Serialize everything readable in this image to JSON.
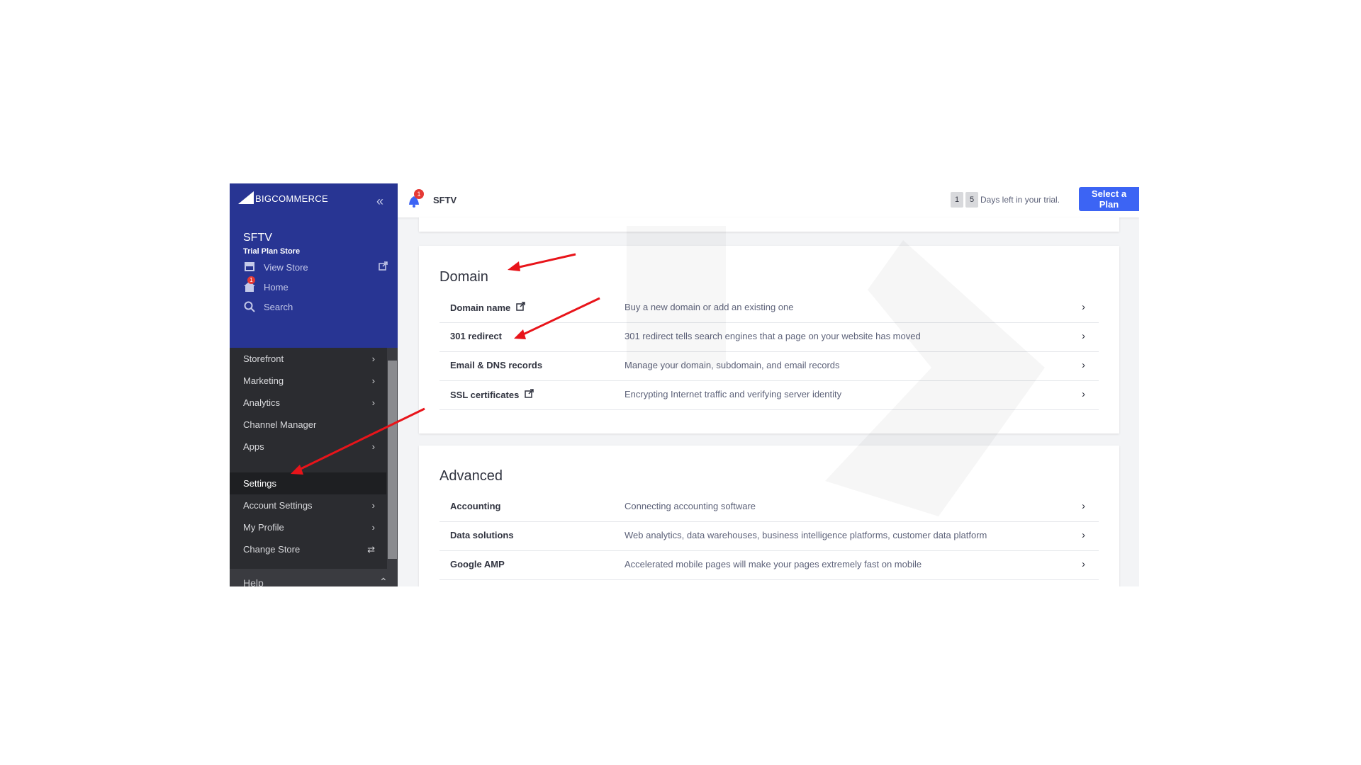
{
  "logo": {
    "text": "BIGCOMMERCE"
  },
  "store": {
    "name": "SFTV",
    "plan": "Trial Plan Store"
  },
  "sidebar_top": {
    "view_store": "View Store",
    "home": "Home",
    "home_badge": "1",
    "search": "Search"
  },
  "menu": [
    {
      "label": "Storefront",
      "chevron": "›"
    },
    {
      "label": "Marketing",
      "chevron": "›"
    },
    {
      "label": "Analytics",
      "chevron": "›"
    },
    {
      "label": "Channel Manager",
      "chevron": ""
    },
    {
      "label": "Apps",
      "chevron": "›"
    },
    {
      "label": "Settings",
      "chevron": ""
    },
    {
      "label": "Account Settings",
      "chevron": "›"
    },
    {
      "label": "My Profile",
      "chevron": "›"
    },
    {
      "label": "Change Store",
      "chevron": "⇄"
    }
  ],
  "help": {
    "label": "Help"
  },
  "topbar": {
    "store": "SFTV",
    "notification_count": "1",
    "trial_digits": [
      "1",
      "5"
    ],
    "trial_text": "Days left in your trial.",
    "select_plan": "Select a Plan"
  },
  "domain_section": {
    "title": "Domain",
    "rows": [
      {
        "name": "Domain name",
        "external": true,
        "desc": "Buy a new domain or add an existing one"
      },
      {
        "name": "301 redirect",
        "external": false,
        "desc": "301 redirect tells search engines that a page on your website has moved"
      },
      {
        "name": "Email & DNS records",
        "external": false,
        "desc": "Manage your domain, subdomain, and email records"
      },
      {
        "name": "SSL certificates",
        "external": true,
        "desc": "Encrypting Internet traffic and verifying server identity"
      }
    ]
  },
  "advanced_section": {
    "title": "Advanced",
    "rows": [
      {
        "name": "Accounting",
        "desc": "Connecting accounting software"
      },
      {
        "name": "Data solutions",
        "desc": "Web analytics, data warehouses, business intelligence platforms, customer data platform"
      },
      {
        "name": "Google AMP",
        "desc": "Accelerated mobile pages will make your pages extremely fast on mobile"
      }
    ]
  },
  "colors": {
    "sidebar_top": "#283593",
    "sidebar_menu": "#2b2c30",
    "accent": "#3c64f4",
    "annotation_arrow": "#e8141a"
  }
}
